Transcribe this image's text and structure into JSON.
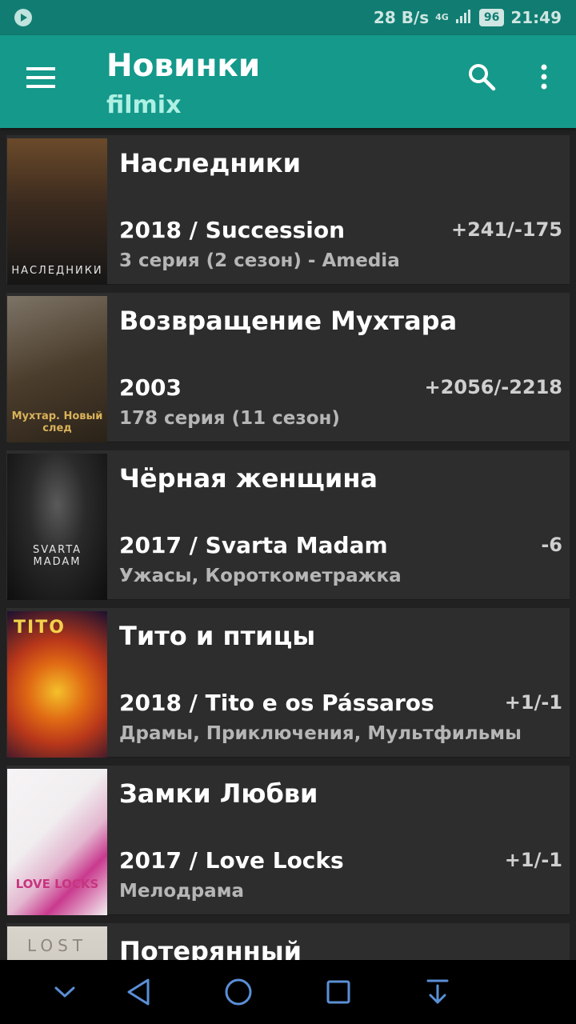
{
  "status_bar": {
    "speed": "28 B/s",
    "network": "4G",
    "battery": "96",
    "time": "21:49"
  },
  "app_bar": {
    "title": "Новинки",
    "subtitle": "filmix"
  },
  "items": [
    {
      "title": "Наследники",
      "year_line": "2018 / Succession",
      "info": "3 серия (2 сезон) - Amedia",
      "rating": "+241/-175",
      "poster_caption": "НАСЛЕДНИКИ",
      "poster_color": "#3a2a1e"
    },
    {
      "title": "Возвращение Мухтара",
      "year_line": "2003",
      "info": "178 серия (11 сезон)",
      "rating": "+2056/-2218",
      "poster_caption": "Мухтар. Новый след",
      "poster_color": "#4b3d2c"
    },
    {
      "title": "Чёрная женщина",
      "year_line": "2017 / Svarta Madam",
      "info": "Ужасы, Короткометражка",
      "rating": "-6",
      "poster_caption": "SVARTA MADAM",
      "poster_color": "#1e1e1e"
    },
    {
      "title": "Тито и птицы",
      "year_line": "2018 / Tito e os Pássaros",
      "info": "Драмы, Приключения, Мультфильмы",
      "rating": "+1/-1",
      "poster_caption": "TITO",
      "poster_color": "#b8371a"
    },
    {
      "title": "Замки Любви",
      "year_line": "2017 / Love Locks",
      "info": "Мелодрама",
      "rating": "+1/-1",
      "poster_caption": "LOVE LOCKS",
      "poster_color": "#f1eef0"
    },
    {
      "title": "Потерянный",
      "year_line": "",
      "info": "",
      "rating": "",
      "poster_caption": "LOST",
      "poster_color": "#d8d4cc"
    }
  ],
  "icons": {
    "status_play": "play-icon",
    "menu": "menu-icon",
    "search": "search-icon",
    "more": "more-vert-icon",
    "nav_collapse": "chevron-down-icon",
    "nav_back": "back-triangle-icon",
    "nav_home": "home-circle-icon",
    "nav_recents": "recents-square-icon",
    "nav_download": "download-arrow-icon"
  },
  "colors": {
    "accent": "#14998a",
    "status_bar": "#117d72",
    "subtitle": "#aef0e4",
    "background": "#212121",
    "card": "#2d2d2d"
  }
}
